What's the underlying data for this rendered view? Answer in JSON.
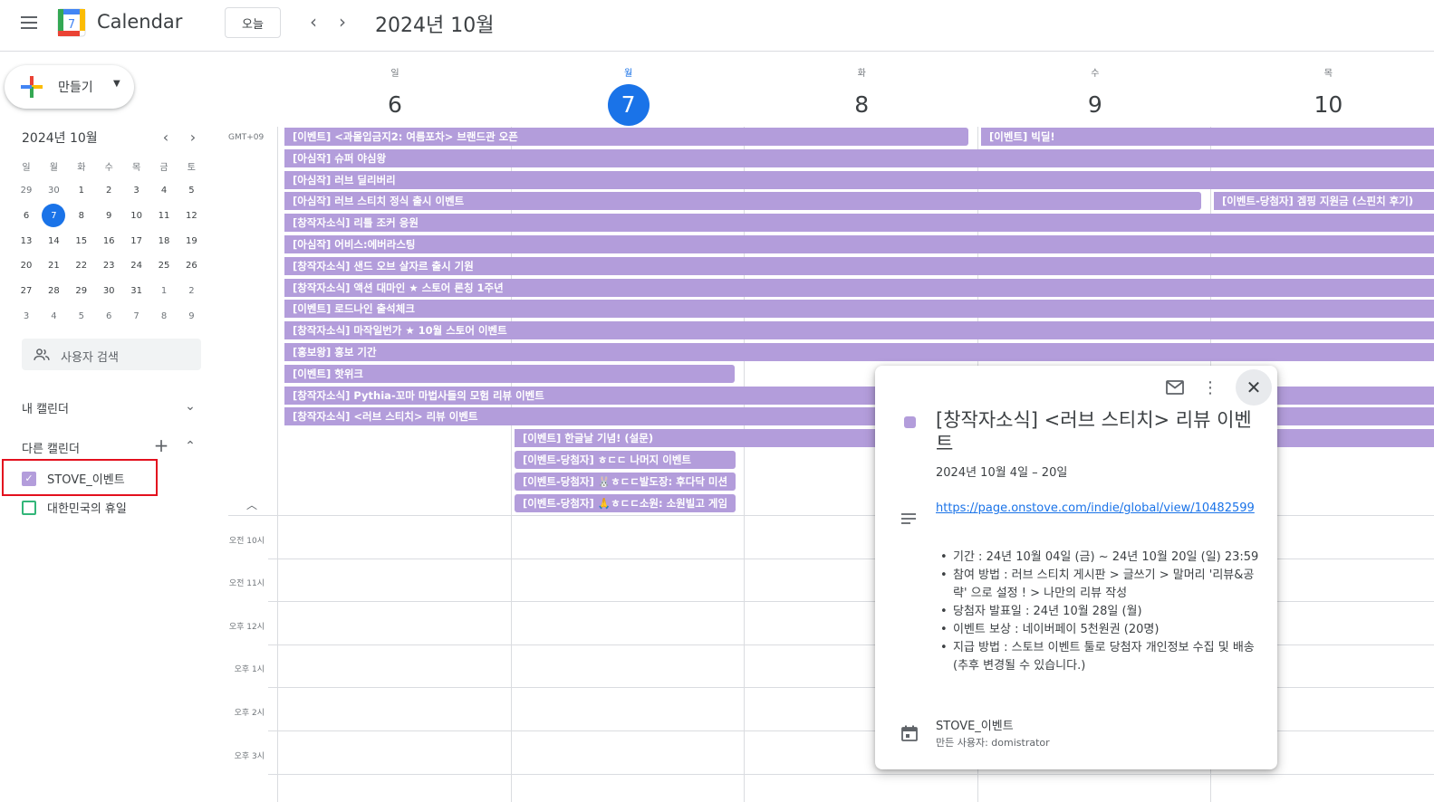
{
  "header": {
    "app_name": "Calendar",
    "logo_day": "7",
    "today_label": "오늘",
    "month_title": "2024년 10월"
  },
  "sidebar": {
    "create_label": "만들기",
    "mini_calendar": {
      "title": "2024년 10월",
      "weekdays": [
        "일",
        "월",
        "화",
        "수",
        "목",
        "금",
        "토"
      ],
      "weeks": [
        [
          "29",
          "30",
          "1",
          "2",
          "3",
          "4",
          "5"
        ],
        [
          "6",
          "7",
          "8",
          "9",
          "10",
          "11",
          "12"
        ],
        [
          "13",
          "14",
          "15",
          "16",
          "17",
          "18",
          "19"
        ],
        [
          "20",
          "21",
          "22",
          "23",
          "24",
          "25",
          "26"
        ],
        [
          "27",
          "28",
          "29",
          "30",
          "31",
          "1",
          "2"
        ],
        [
          "3",
          "4",
          "5",
          "6",
          "7",
          "8",
          "9"
        ]
      ],
      "today": "7"
    },
    "user_search_label": "사용자 검색",
    "my_calendars_label": "내 캘린더",
    "other_calendars_label": "다른 캘린더",
    "other_calendars": [
      {
        "name": "STOVE_이벤트",
        "checked": true,
        "color": "#b39ddb"
      },
      {
        "name": "대한민국의 휴일",
        "checked": false,
        "color": "#33b679"
      }
    ]
  },
  "grid": {
    "timezone": "GMT+09",
    "days": [
      {
        "name": "일",
        "num": "6",
        "today": false
      },
      {
        "name": "월",
        "num": "7",
        "today": true
      },
      {
        "name": "화",
        "num": "8",
        "today": false
      },
      {
        "name": "수",
        "num": "9",
        "today": false
      },
      {
        "name": "목",
        "num": "10",
        "today": false
      }
    ],
    "time_labels": [
      "오전 10시",
      "오전 11시",
      "오후 12시",
      "오후 1시",
      "오후 2시",
      "오후 3시"
    ],
    "events": [
      {
        "title": "[이벤트] <과몰입금지2: 여름포차> 브랜드관 오픈",
        "start": 0,
        "end": 3,
        "row": 0,
        "cont": true
      },
      {
        "title": "[이벤트] 빅딜!",
        "start": 3,
        "end": 5,
        "row": 0,
        "cont": false
      },
      {
        "title": "[아심작] 슈퍼 야심왕",
        "start": 0,
        "end": 5,
        "row": 1,
        "cont": true
      },
      {
        "title": "[아심작] 러브 딜리버리",
        "start": 0,
        "end": 5,
        "row": 2,
        "cont": true
      },
      {
        "title": "[아심작] 러브 스티치 정식 출시 이벤트",
        "start": 0,
        "end": 4,
        "row": 3,
        "cont": true
      },
      {
        "title": "[이벤트-당첨자] 겜핑 지원금 (스핀치 후기)",
        "start": 4,
        "end": 5,
        "row": 3,
        "cont": false
      },
      {
        "title": "[창작자소식] 리틀 조커 응원",
        "start": 0,
        "end": 5,
        "row": 4,
        "cont": true
      },
      {
        "title": "[아심작] 어비스:에버라스팅",
        "start": 0,
        "end": 5,
        "row": 5,
        "cont": true
      },
      {
        "title": "[창작자소식] 샌드 오브 살자르 출시 기원",
        "start": 0,
        "end": 5,
        "row": 6,
        "cont": true
      },
      {
        "title": "[창작자소식] 액션 대마인 ★ 스토어 론칭 1주년",
        "start": 0,
        "end": 5,
        "row": 7,
        "cont": true
      },
      {
        "title": "[이벤트] 로드나인 출석체크",
        "start": 0,
        "end": 5,
        "row": 8,
        "cont": true
      },
      {
        "title": "[창작자소식] 마작일번가 ★ 10월 스토어 이벤트",
        "start": 0,
        "end": 5,
        "row": 9,
        "cont": true
      },
      {
        "title": "[홍보왕] 홍보 기간",
        "start": 0,
        "end": 5,
        "row": 10,
        "cont": true
      },
      {
        "title": "[이벤트] 핫위크",
        "start": 0,
        "end": 2,
        "row": 11,
        "cont": true
      },
      {
        "title": "[창작자소식] Pythia-꼬마 마법사들의 모험 리뷰 이벤트",
        "start": 0,
        "end": 5,
        "row": 12,
        "cont": true
      },
      {
        "title": "[창작자소식] <러브 스티치> 리뷰 이벤트",
        "start": 0,
        "end": 5,
        "row": 13,
        "cont": true
      },
      {
        "title": "[이벤트] 한글날 기념! (설문)",
        "start": 1,
        "end": 5,
        "row": 14,
        "cont": false
      },
      {
        "title": "[이벤트-당첨자] ㅎㄷㄷ 나머지 이벤트",
        "start": 1,
        "end": 2,
        "row": 15,
        "cont": false
      },
      {
        "title": "[이벤트-당첨자] 🐰ㅎㄷㄷ발도장: 후다닥 미션",
        "start": 1,
        "end": 2,
        "row": 16,
        "cont": false
      },
      {
        "title": "[이벤트-당첨자] 🙏ㅎㄷㄷ소원: 소원빌고 게임",
        "start": 1,
        "end": 2,
        "row": 17,
        "cont": false
      }
    ]
  },
  "popup": {
    "title": "[창작자소식] <러브 스티치> 리뷰 이벤트",
    "date_range": "2024년 10월 4일 – 20일",
    "link": "https://page.onstove.com/indie/global/view/10482599",
    "details": [
      "기간 : 24년 10월 04일 (금) ~ 24년 10월 20일 (일) 23:59",
      "참여 방법 : 러브 스티치 게시판 > 글쓰기 > 말머리 '리뷰&공략' 으로 설정 ! > 나만의 리뷰 작성",
      "당첨자 발표일 : 24년 10월 28일 (월)",
      "이벤트 보상 : 네이버페이 5천원권 (20명)",
      "지급 방법 : 스토브 이벤트 툴로 당첨자 개인정보 수집 및 배송 (추후 변경될 수 있습니다.)"
    ],
    "calendar_name": "STOVE_이벤트",
    "creator": "만든 사용자: domistrator",
    "color": "#b39ddb"
  }
}
